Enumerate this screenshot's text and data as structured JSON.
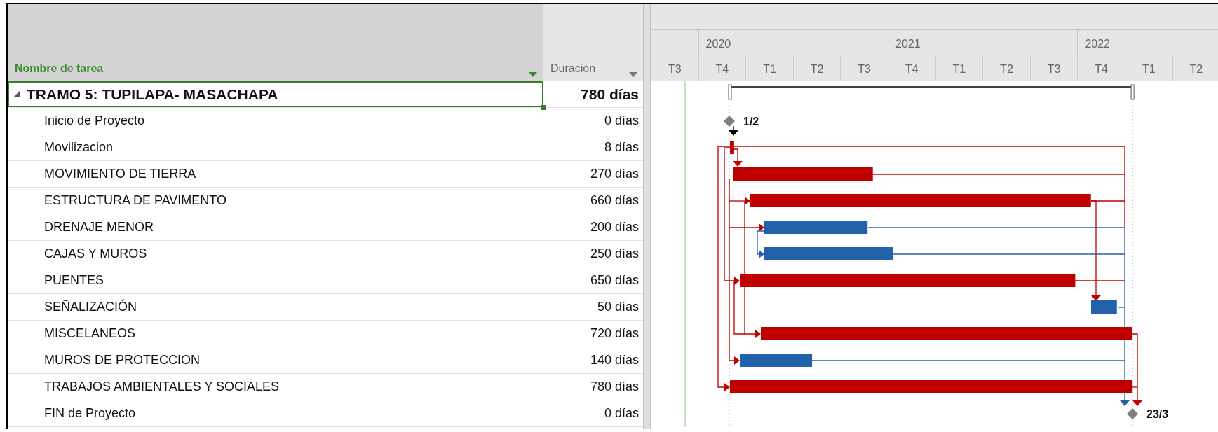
{
  "table": {
    "columns": [
      {
        "label": "Nombre de tarea",
        "selected": true
      },
      {
        "label": "Duración",
        "selected": false
      }
    ],
    "rows": [
      {
        "kind": "summary",
        "name": "TRAMO 5: TUPILAPA- MASACHAPA",
        "duration": "780 días",
        "expanded": true,
        "selected": true
      },
      {
        "kind": "milestone",
        "name": "Inicio de Proyecto",
        "duration": "0 días",
        "date_label": "1/2",
        "selected": false
      },
      {
        "kind": "task",
        "name": "Movilizacion",
        "duration": "8 días",
        "critical": true,
        "selected": false
      },
      {
        "kind": "task",
        "name": "MOVIMIENTO DE TIERRA",
        "duration": "270 días",
        "critical": true,
        "selected": false
      },
      {
        "kind": "task",
        "name": "ESTRUCTURA DE PAVIMENTO",
        "duration": "660 días",
        "critical": true,
        "selected": false
      },
      {
        "kind": "task",
        "name": "DRENAJE MENOR",
        "duration": "200 días",
        "critical": false,
        "selected": false
      },
      {
        "kind": "task",
        "name": "CAJAS Y MUROS",
        "duration": "250 días",
        "critical": false,
        "selected": false
      },
      {
        "kind": "task",
        "name": "PUENTES",
        "duration": "650 días",
        "critical": true,
        "selected": false
      },
      {
        "kind": "task",
        "name": "SEÑALIZACIÓN",
        "duration": "50 días",
        "critical": false,
        "selected": false
      },
      {
        "kind": "task",
        "name": "MISCELANEOS",
        "duration": "720 días",
        "critical": true,
        "selected": false
      },
      {
        "kind": "task",
        "name": "MUROS DE PROTECCION",
        "duration": "140 días",
        "critical": false,
        "selected": false
      },
      {
        "kind": "task",
        "name": "TRABAJOS AMBIENTALES Y SOCIALES",
        "duration": "780 días",
        "critical": true,
        "selected": false
      },
      {
        "kind": "milestone",
        "name": "FIN de Proyecto",
        "duration": "0 días",
        "date_label": "23/3",
        "selected": false
      }
    ]
  },
  "timescale": {
    "years": [
      "2020",
      "2021",
      "2022"
    ],
    "quarters": [
      "T3",
      "T4",
      "T1",
      "T2",
      "T3",
      "T4",
      "T1",
      "T2",
      "T3",
      "T4",
      "T1",
      "T2"
    ]
  }
}
